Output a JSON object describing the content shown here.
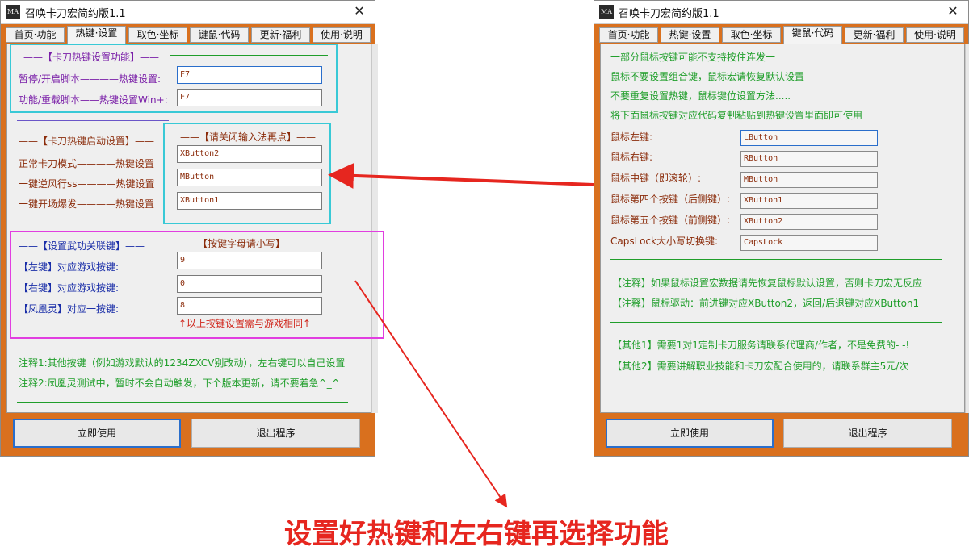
{
  "left_window": {
    "title": "召唤卡刀宏简约版1.1",
    "close": "✕",
    "tabs": [
      {
        "label": "首页·功能",
        "active": false
      },
      {
        "label": "热键·设置",
        "active": true
      },
      {
        "label": "取色·坐标",
        "active": false
      },
      {
        "label": "键鼠·代码",
        "active": false
      },
      {
        "label": "更新·福利",
        "active": false
      },
      {
        "label": "使用·说明",
        "active": false
      }
    ],
    "section1": {
      "header": "——【卡刀热键设置功能】——",
      "row1_label": "暂停/开启脚本————热键设置:",
      "row1_value": "F7",
      "row2_label": "功能/重载脚本——热键设置Win+:",
      "row2_value": "F7"
    },
    "section2": {
      "header": "——【卡刀热键启动设置】——",
      "hint": "——【请关闭输入法再点】——",
      "row1_label": "正常卡刀模式————热键设置",
      "row1_value": "XButton2",
      "row2_label": "一键逆风行ss————热键设置",
      "row2_value": "MButton",
      "row3_label": "一键开场爆发————热键设置",
      "row3_value": "XButton1"
    },
    "section3": {
      "header": "——【设置武功关联键】——",
      "hint": "——【按键字母请小写】——",
      "row1_label": "【左键】对应游戏按键:",
      "row1_value": "9",
      "row2_label": "【右键】对应游戏按键:",
      "row2_value": "0",
      "row3_label": "【凤凰灵】对应一按键:",
      "row3_value": "8",
      "note": "↑以上按键设置需与游戏相同↑"
    },
    "notes": [
      "注释1:其他按键（例如游戏默认的1234ZXCV别改动），左右键可以自己设置",
      "注释2:凤凰灵测试中，暂时不会自动触发，下个版本更新，请不要着急^_^"
    ],
    "btn_use": "立即使用",
    "btn_exit": "退出程序"
  },
  "right_window": {
    "title": "召唤卡刀宏简约版1.1",
    "close": "✕",
    "tabs": [
      {
        "label": "首页·功能",
        "active": false
      },
      {
        "label": "热键·设置",
        "active": false
      },
      {
        "label": "取色·坐标",
        "active": false
      },
      {
        "label": "键鼠·代码",
        "active": true
      },
      {
        "label": "更新·福利",
        "active": false
      },
      {
        "label": "使用·说明",
        "active": false
      }
    ],
    "intro": [
      "一部分鼠标按键可能不支持按住连发一",
      "鼠标不要设置组合键，鼠标宏请恢复默认设置",
      "不要重复设置热键，鼠标键位设置方法.....",
      "将下面鼠标按键对应代码复制粘贴到热键设置里面即可使用"
    ],
    "codes": [
      {
        "label": "鼠标左键:",
        "value": "LButton"
      },
      {
        "label": "鼠标右键:",
        "value": "RButton"
      },
      {
        "label": "鼠标中键（即滚轮）:",
        "value": "MButton"
      },
      {
        "label": "鼠标第四个按键（后侧键）:",
        "value": "XButton1"
      },
      {
        "label": "鼠标第五个按键（前侧键）:",
        "value": "XButton2"
      },
      {
        "label": "CapsLock大小写切换键:",
        "value": "CapsLock"
      }
    ],
    "notes1": [
      "【注释】如果鼠标设置宏数据请先恢复鼠标默认设置，否则卡刀宏无反应",
      "【注释】鼠标驱动：前进键对应XButton2，返回/后退键对应XButton1"
    ],
    "notes2": [
      "【其他1】需要1对1定制卡刀服务请联系代理商/作者，不是免费的- -!",
      "【其他2】需要讲解职业技能和卡刀宏配合使用的，请联系群主5元/次"
    ],
    "btn_use": "立即使用",
    "btn_exit": "退出程序"
  },
  "caption": "设置好热键和左右键再选择功能",
  "colors": {
    "frame": "#d9701e",
    "annotation_red": "#e6261f",
    "cyan_box": "#39c9d6",
    "magenta_box": "#e13ee0",
    "purple_text": "#7a1fa8",
    "brown_text": "#8b2c0b",
    "green_text": "#1f9e2a"
  }
}
